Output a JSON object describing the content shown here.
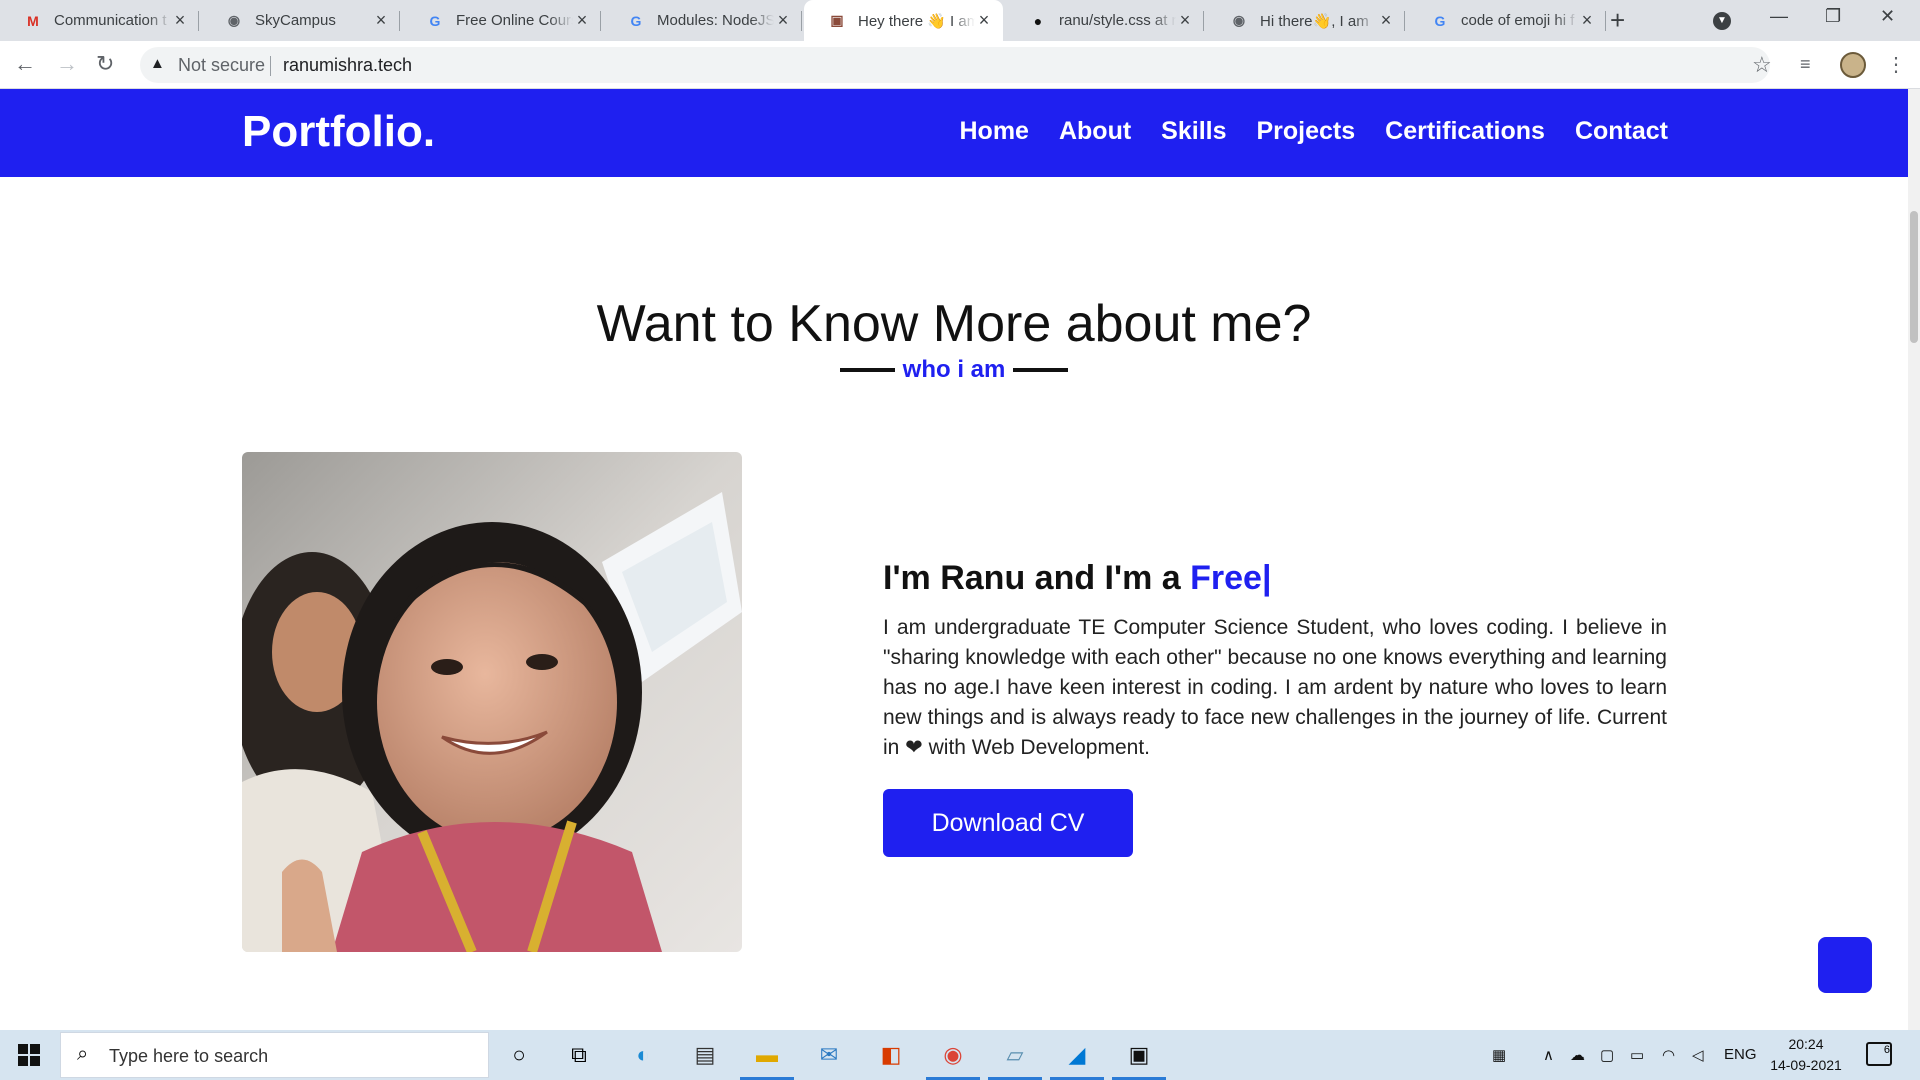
{
  "browser": {
    "tabs": [
      {
        "title": "Communication t",
        "favicon": "gmail-icon",
        "fav_glyph": "M",
        "fav_color": "#d93025"
      },
      {
        "title": "SkyCampus",
        "favicon": "globe-icon",
        "fav_glyph": "◉",
        "fav_color": "#5f6368"
      },
      {
        "title": "Free Online Cours",
        "favicon": "google-icon",
        "fav_glyph": "G",
        "fav_color": "#4285f4"
      },
      {
        "title": "Modules: NodeJS",
        "favicon": "google-icon",
        "fav_glyph": "G",
        "fav_color": "#4285f4"
      },
      {
        "title": "Hey there 👋 I am",
        "favicon": "avatar-favicon-icon",
        "fav_glyph": "▣",
        "fav_color": "#8a4a3a",
        "active": true
      },
      {
        "title": "ranu/style.css at r",
        "favicon": "github-icon",
        "fav_glyph": "●",
        "fav_color": "#111"
      },
      {
        "title": "Hi there👋, I am",
        "favicon": "globe-icon",
        "fav_glyph": "◉",
        "fav_color": "#5f6368"
      },
      {
        "title": "code of emoji hi f",
        "favicon": "google-icon",
        "fav_glyph": "G",
        "fav_color": "#4285f4"
      }
    ],
    "security_label": "Not secure",
    "url": "ranumishra.tech"
  },
  "site": {
    "brand": "Portfolio.",
    "nav": [
      "Home",
      "About",
      "Skills",
      "Projects",
      "Certifications",
      "Contact"
    ],
    "accent_color": "#1f20f0",
    "about": {
      "heading": "Want to Know More about me?",
      "subheading": "who i am",
      "intro_prefix": "I'm Ranu and I'm a ",
      "intro_role": "Free|",
      "bio": "I am undergraduate TE Computer Science Student, who loves coding. I believe in \"sharing knowledge with each other\" because no one knows everything and learning has no age.I have keen interest in coding. I am ardent by nature who loves to learn new things and is always ready to face new challenges in the journey of life. Current in ❤ with Web Development.",
      "download_label": "Download CV"
    }
  },
  "taskbar": {
    "search_placeholder": "Type here to search",
    "language": "ENG",
    "time": "20:24",
    "date": "14-09-2021",
    "notification_count": "6"
  }
}
